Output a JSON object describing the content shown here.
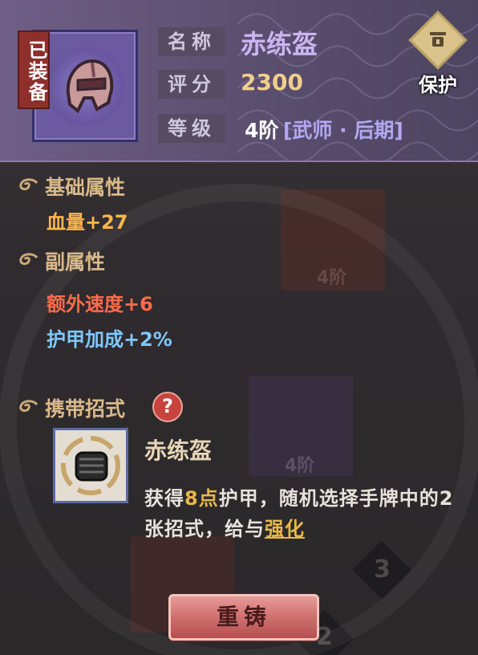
{
  "item": {
    "equipped_badge": "已装备",
    "icon": "helmet-icon",
    "name_label": "名称",
    "name": "赤练盔",
    "score_label": "评分",
    "score": "2300",
    "level_label": "等级",
    "level_value": "4阶",
    "level_stage": "[武师 · 后期]"
  },
  "protect": {
    "label": "保护",
    "icon": "lock-icon"
  },
  "base_attrs": {
    "title": "基础属性",
    "items": [
      "血量+27"
    ]
  },
  "sub_attrs": {
    "title": "副属性",
    "items": [
      "额外速度+6",
      "护甲加成+2%"
    ]
  },
  "skill": {
    "section_title": "携带招式",
    "help_symbol": "?",
    "name": "赤练盔",
    "icon": "fist-icon",
    "desc_part1": "获得",
    "desc_highlight": "8点",
    "desc_part2": "护甲，随机选择手牌中的2张招式，给与",
    "desc_link": "强化"
  },
  "background": {
    "card_levels": [
      "4阶",
      "4阶"
    ],
    "slot_numbers": [
      "3",
      "2"
    ]
  },
  "actions": {
    "recast_label": "重铸"
  },
  "colors": {
    "header": "#6f5e86",
    "score_gold": "#f0cf8a",
    "stat_orange": "#ffb64a",
    "speed_red": "#ff6b4a",
    "armor_blue": "#7ec8ff",
    "button_pink": "#d27472"
  }
}
